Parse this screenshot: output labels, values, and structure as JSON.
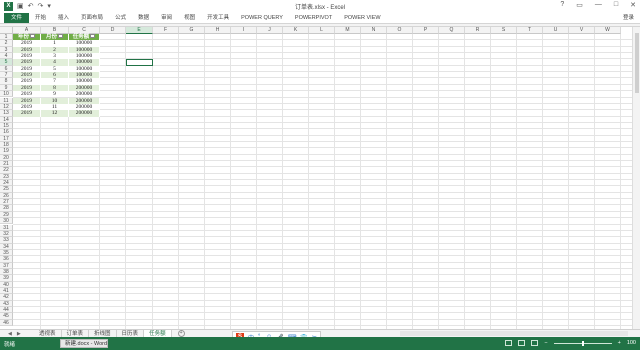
{
  "window": {
    "title": "订单表.xlsx - Excel",
    "app_icon": "excel-logo",
    "controls": [
      "?",
      "▭",
      "—",
      "□",
      "✕"
    ],
    "login": "登录"
  },
  "qat": [
    "save-icon",
    "undo-icon",
    "redo-icon",
    "customize-icon"
  ],
  "ribbon": {
    "tabs": [
      "文件",
      "开始",
      "插入",
      "页面布局",
      "公式",
      "数据",
      "审阅",
      "视图",
      "开发工具",
      "POWER QUERY",
      "POWERPIVOT",
      "POWER VIEW"
    ]
  },
  "sheet": {
    "columns": [
      "A",
      "B",
      "C",
      "D",
      "E",
      "F",
      "G",
      "H",
      "I",
      "J",
      "K",
      "L",
      "M",
      "N",
      "O",
      "P",
      "Q",
      "R",
      "S",
      "T",
      "U",
      "V",
      "W"
    ],
    "selected_column": "E",
    "selected_row": 5,
    "row_count": 46,
    "table": {
      "headers": [
        "年份",
        "月份",
        "任务额"
      ],
      "rows": [
        [
          "2019",
          "1",
          "100000"
        ],
        [
          "2019",
          "2",
          "100000"
        ],
        [
          "2019",
          "3",
          "100000"
        ],
        [
          "2019",
          "4",
          "100000"
        ],
        [
          "2019",
          "5",
          "100000"
        ],
        [
          "2019",
          "6",
          "100000"
        ],
        [
          "2019",
          "7",
          "100000"
        ],
        [
          "2019",
          "8",
          "200000"
        ],
        [
          "2019",
          "9",
          "200000"
        ],
        [
          "2019",
          "10",
          "200000"
        ],
        [
          "2019",
          "11",
          "200000"
        ],
        [
          "2019",
          "12",
          "200000"
        ]
      ],
      "header_color": "#70ad47",
      "band_color": "#e2efda"
    }
  },
  "sheet_tabs": {
    "nav": [
      "◀",
      "▶"
    ],
    "tabs": [
      "透视表",
      "订单表",
      "折线图",
      "日历表",
      "任务额"
    ],
    "active": "任务额",
    "add": "+"
  },
  "ime": {
    "brand": "S",
    "items": [
      "中",
      "°,",
      "☺",
      "🎤",
      "⌨",
      "👕",
      "✂"
    ]
  },
  "statusbar": {
    "ready": "就绪",
    "task": "新建.docx - Word",
    "zoom": "100"
  },
  "accent": "#217346"
}
